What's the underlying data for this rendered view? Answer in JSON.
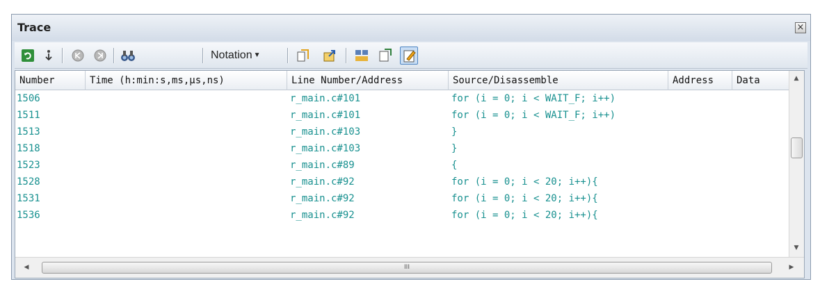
{
  "window": {
    "title": "Trace",
    "close_icon": "close-icon"
  },
  "toolbar": {
    "buttons": [
      {
        "name": "refresh-icon"
      },
      {
        "name": "step-icon"
      },
      {
        "name": "step-back-icon"
      },
      {
        "name": "step-forward-icon"
      },
      {
        "name": "binoculars-icon"
      },
      {
        "name": "copy-icon"
      },
      {
        "name": "export-icon"
      },
      {
        "name": "mix-display-icon"
      },
      {
        "name": "clear-icon"
      },
      {
        "name": "edit-icon"
      }
    ],
    "notation_label": "Notation"
  },
  "table": {
    "columns": [
      "Number",
      "Time (h:min:s,ms,µs,ns)",
      "Line Number/Address",
      "Source/Disassemble",
      "Address",
      "Data"
    ],
    "rows": [
      {
        "number": "1506",
        "time": "",
        "line": "r_main.c#101",
        "source": "for (i = 0; i < WAIT_F; i++)",
        "address": "",
        "data": ""
      },
      {
        "number": "1511",
        "time": "",
        "line": "r_main.c#101",
        "source": "for (i = 0; i < WAIT_F; i++)",
        "address": "",
        "data": ""
      },
      {
        "number": "1513",
        "time": "",
        "line": "r_main.c#103",
        "source": "}",
        "address": "",
        "data": ""
      },
      {
        "number": "1518",
        "time": "",
        "line": "r_main.c#103",
        "source": "}",
        "address": "",
        "data": ""
      },
      {
        "number": "1523",
        "time": "",
        "line": "r_main.c#89",
        "source": "{",
        "address": "",
        "data": ""
      },
      {
        "number": "1528",
        "time": "",
        "line": "r_main.c#92",
        "source": "for (i = 0; i < 20; i++){",
        "address": "",
        "data": ""
      },
      {
        "number": "1531",
        "time": "",
        "line": "r_main.c#92",
        "source": "for (i = 0; i < 20; i++){",
        "address": "",
        "data": ""
      },
      {
        "number": "1536",
        "time": "",
        "line": "r_main.c#92",
        "source": "for (i = 0; i < 20; i++){",
        "address": "",
        "data": ""
      }
    ]
  },
  "scrollbar": {
    "h_thumb_grip": "III"
  },
  "colors": {
    "row_text": "#17908f",
    "header_bg": "#dce4ee"
  }
}
